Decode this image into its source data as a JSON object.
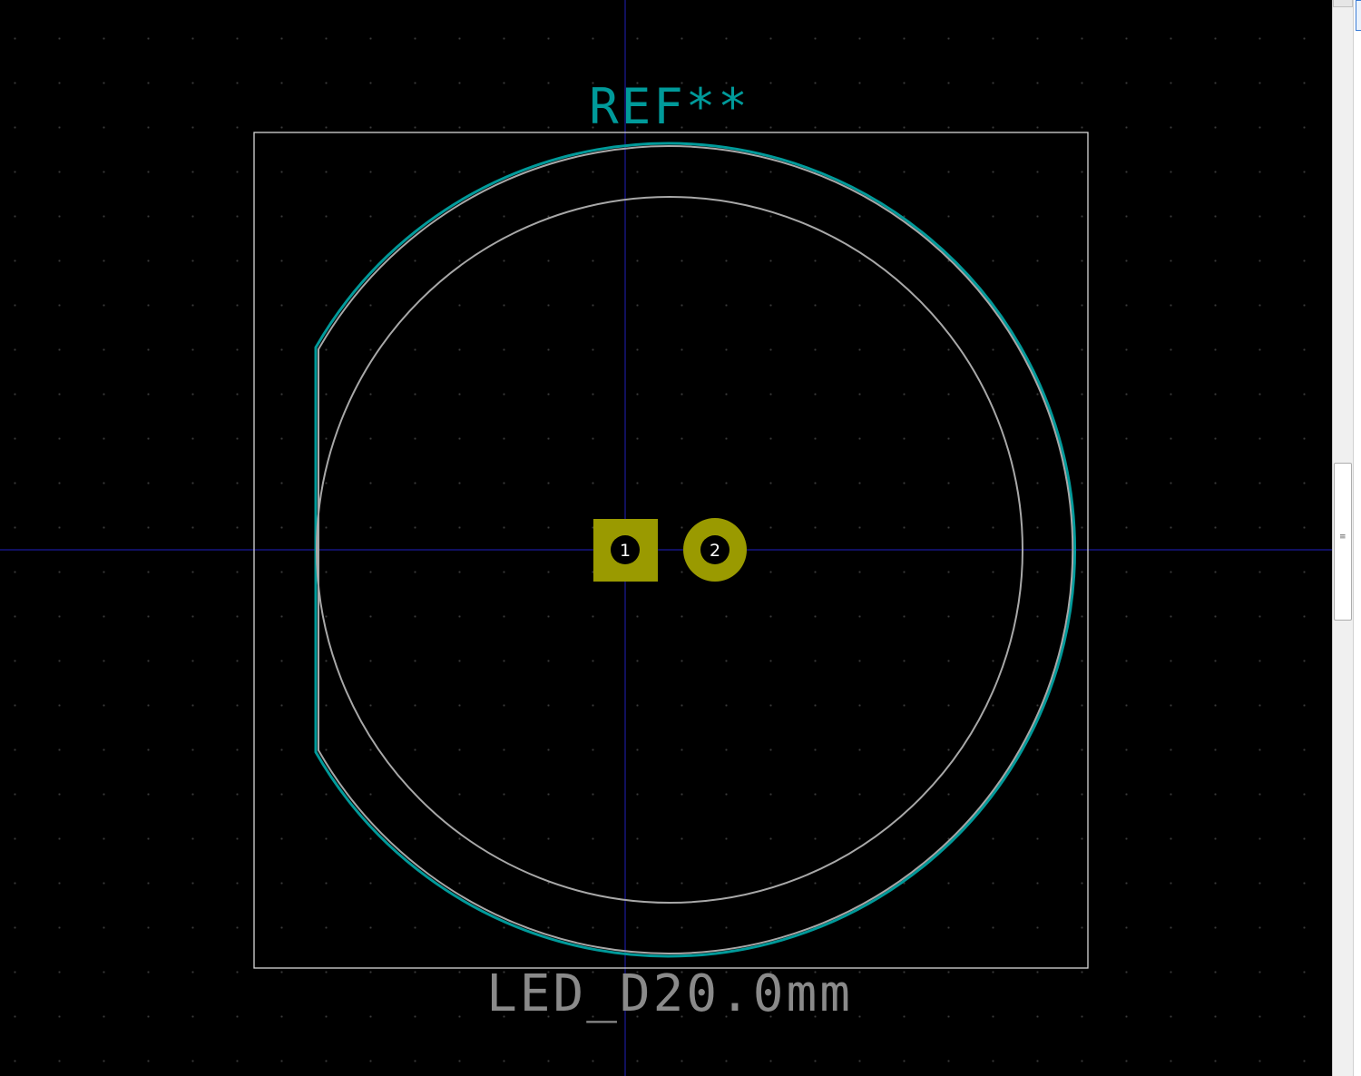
{
  "footprint": {
    "reference": "REF**",
    "value": "LED_D20.0mm"
  },
  "pads": [
    {
      "number": "1",
      "shape": "rect"
    },
    {
      "number": "2",
      "shape": "circle"
    }
  ],
  "colors": {
    "background": "#000000",
    "grid": "#3a3a3a",
    "crosshair": "#1a1a9a",
    "silkscreen": "#009a9a",
    "fab_layer": "#a8a8a8",
    "courtyard": "#d8d8d8",
    "pad": "#9a9a00",
    "pad_hole": "#000000",
    "pad_number": "#ffffff"
  },
  "icons": {
    "scroll_grip": "grip-lines-icon"
  }
}
